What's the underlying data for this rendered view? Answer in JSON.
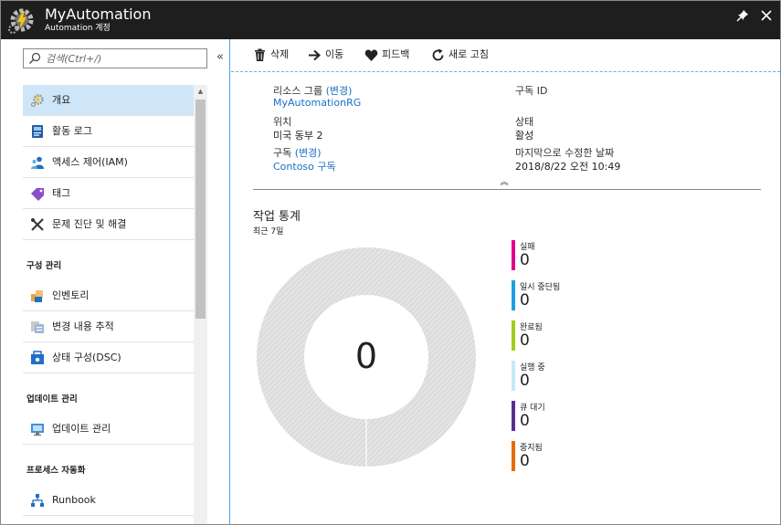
{
  "app": {
    "title": "MyAutomation",
    "subtitle": "Automation 계정"
  },
  "search": {
    "placeholder": "검색(Ctrl+/)"
  },
  "sidebar": {
    "items": [
      {
        "label": "개요",
        "active": true
      },
      {
        "label": "활동 로그"
      },
      {
        "label": "액세스 제어(IAM)"
      },
      {
        "label": "태그"
      },
      {
        "label": "문제 진단 및 해결"
      }
    ],
    "section_config": "구성 관리",
    "config_items": [
      {
        "label": "인벤토리"
      },
      {
        "label": "변경 내용 추적"
      },
      {
        "label": "상태 구성(DSC)"
      }
    ],
    "section_update": "업데이트 관리",
    "update_items": [
      {
        "label": "업데이트 관리"
      }
    ],
    "section_process": "프로세스 자동화",
    "process_items": [
      {
        "label": "Runbook"
      }
    ]
  },
  "toolbar": {
    "delete_label": "삭제",
    "move_label": "이동",
    "feedback_label": "피드백",
    "refresh_label": "새로 고침"
  },
  "essentials": {
    "resource_group_label": "리소스 그룹",
    "resource_group_change": "(변경)",
    "resource_group_value": "MyAutomationRG",
    "location_label": "위치",
    "location_value": "미국 동부 2",
    "subscription_label": "구독",
    "subscription_change": "(변경)",
    "subscription_value": "Contoso 구독",
    "subscription_id_label": "구독 ID",
    "status_label": "상태",
    "status_value": "활성",
    "last_modified_label": "마지막으로 수정한 날짜",
    "last_modified_value": "2018/8/22 오전 10:49"
  },
  "job_stats": {
    "title": "작업 통계",
    "subtitle": "최근 7일",
    "total": "0",
    "legend": [
      {
        "name": "실패",
        "value": "0",
        "color": "#e3008c"
      },
      {
        "name": "일시 중단됨",
        "value": "0",
        "color": "#1ba1e2"
      },
      {
        "name": "완료됨",
        "value": "0",
        "color": "#9ecd1d"
      },
      {
        "name": "실행 중",
        "value": "0",
        "color": "#c7e8f8"
      },
      {
        "name": "큐 대기",
        "value": "0",
        "color": "#5c2d91"
      },
      {
        "name": "중지됨",
        "value": "0",
        "color": "#e46c0a"
      }
    ]
  },
  "colors": {
    "accent": "#1a6fc6",
    "titlebar": "#1e1e1e",
    "active_nav": "#cfe6f8"
  }
}
